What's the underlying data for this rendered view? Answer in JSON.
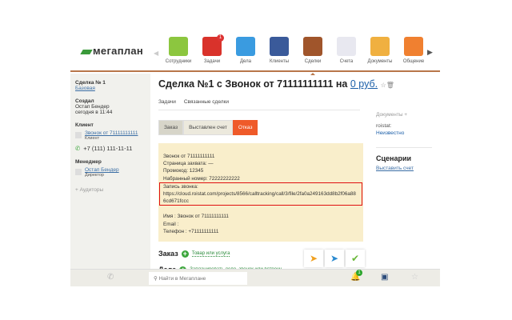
{
  "header": {
    "logo": "мегаплан",
    "nav": [
      {
        "label": "Сотрудники",
        "color": "#8cc63f"
      },
      {
        "label": "Задачи",
        "color": "#d9322b",
        "badge": "1"
      },
      {
        "label": "Дела",
        "color": "#3a9be0"
      },
      {
        "label": "Клиенты",
        "color": "#3a5a9a"
      },
      {
        "label": "Сделки",
        "color": "#a0552b",
        "active": true
      },
      {
        "label": "Счета",
        "color": "#e8e8f0"
      },
      {
        "label": "Документы",
        "color": "#f0b040"
      },
      {
        "label": "Общение",
        "color": "#f08030"
      }
    ]
  },
  "sidebar": {
    "deal_label": "Сделка № 1",
    "deal_type": "Базовая",
    "created_label": "Создал",
    "creator": "Остап Бендер",
    "created_time": "сегодня в 11:44",
    "client_label": "Клиент",
    "client_name": "Звонок от 71111111111",
    "client_role": "Клиент",
    "client_phone": "+7 (111) 111-11-11",
    "manager_label": "Менеджер",
    "manager_name": "Остап Бендер",
    "manager_role": "Директор",
    "auditors": "+ Аудиторы"
  },
  "main": {
    "title": "Сделка №1 с Звонок от 71111111111 на",
    "amount": "0 руб.",
    "tabs": [
      "Задачи",
      "Связанные сделки"
    ],
    "stages": [
      "Заказ",
      "Выставлен счет",
      "Отказ"
    ],
    "note": {
      "lines1": [
        "Звонок от 71111111111",
        "Страница захвата: —",
        "Промокод: 12345",
        "Набранный номер: 72222222222"
      ],
      "rec_label": "Запись звонка:",
      "rec_url": "https://cloud.roistat.com/projects/8566/calltracking/call/3/file/2fa0a249163dd8b2f06a886cd671fccc",
      "lines2": [
        "Имя : Звонок от 71111111111",
        "Email :",
        "Телефон : +71111111111"
      ]
    },
    "order_label": "Заказ",
    "order_link": "Товар или услуга",
    "tasks_label": "Дела",
    "tasks_link": "Запланировать дело, звонок или встречу"
  },
  "right": {
    "docs": "Документы +",
    "roistat_label": "roistat:",
    "roistat_value": "Неизвестно",
    "scenarios": "Сценарии",
    "scenario_link": "Выставить счет"
  },
  "bottom": {
    "search_placeholder": "Найти в Мегаплане",
    "notif_count": "1"
  }
}
